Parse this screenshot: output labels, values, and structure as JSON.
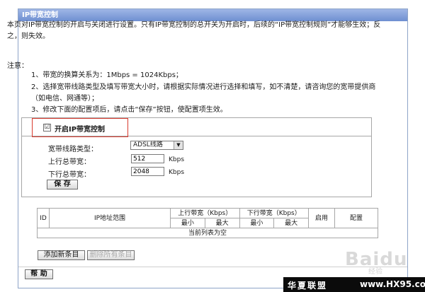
{
  "window": {
    "title": "IP带宽控制"
  },
  "intro": {
    "description": "本页对IP带宽控制的开启与关闭进行设置。只有IP带宽控制的总开关为开启时，后续的“IP带宽控制规则”才能够生效；反之，则失效。",
    "note_title": "注意：",
    "notes": [
      "1、带宽的换算关系为：1Mbps = 1024Kbps；",
      "2、选择宽带线路类型及填写带宽大小时，请根据实际情况进行选择和填写，如不清楚，请咨询您的宽带提供商（如电信、网通等）；",
      "3、修改下面的配置项后，请点击“保存”按钮，使配置项生效。"
    ]
  },
  "settings": {
    "enable_checked": "☑",
    "enable_label": "开启IP带宽控制",
    "line_type_label": "宽带线路类型：",
    "line_type_value": "ADSL线路",
    "upload_label": "上行总带宽：",
    "upload_value": "512",
    "upload_unit": "Kbps",
    "download_label": "下行总带宽：",
    "download_value": "2048",
    "download_unit": "Kbps",
    "save_label": "保 存"
  },
  "rules_table": {
    "col_id": "ID",
    "col_ip_range": "IP地址范围",
    "col_upload": "上行带宽（Kbps）",
    "col_download": "下行带宽（Kbps）",
    "col_enable": "启用",
    "col_config": "配置",
    "sub_min": "最小",
    "sub_max": "最大",
    "empty_text": "当前列表为空"
  },
  "actions": {
    "add_label": "添加新条目",
    "delete_all_label": "删除所有条目",
    "help_label": "帮 助"
  },
  "branding": {
    "watermark": "Baidu",
    "watermark_sub": "经验",
    "footer_name": "华夏联盟",
    "footer_url": "www.HX95.com"
  },
  "colors": {
    "titlebar": "#7c9ad6",
    "highlight": "#d83a2e",
    "border": "#a7a7a7"
  }
}
